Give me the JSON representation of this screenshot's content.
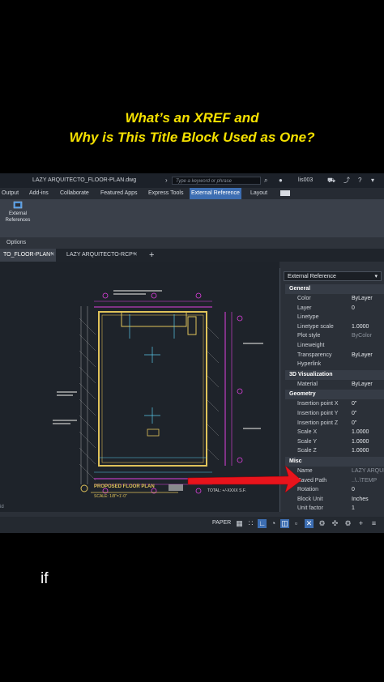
{
  "caption": {
    "line1": "What’s an XREF and",
    "line2": "Why is This Title Block Used as One?"
  },
  "app": {
    "window_title": "LAZY ARQUITECTO_FLOOR-PLAN.dwg",
    "search_placeholder": "Type a keyword or phrase",
    "user": "lis003",
    "ribbon_tabs": [
      "Output",
      "Add-ins",
      "Collaborate",
      "Featured Apps",
      "Express Tools",
      "External Reference",
      "Layout"
    ],
    "active_ribbon_tab": "External Reference",
    "ribbon_button": {
      "line1": "External",
      "line2": "References"
    },
    "ribbon_panel": "Options",
    "file_tabs": [
      "TO_FLOOR-PLAN*",
      "LAZY ARQUITECTO-RCP*"
    ],
    "command_prefix": "id",
    "drawing": {
      "plan_label": "PROPOSED FLOOR PLAN",
      "scale_label": "SCALE: 1/8\"=1'-0\"",
      "total_label": "TOTAL: +/-XXXX S.F."
    }
  },
  "properties": {
    "header": "External Reference",
    "sections": [
      {
        "title": "General",
        "rows": [
          {
            "key": "Color",
            "value": "ByLayer"
          },
          {
            "key": "Layer",
            "value": "0"
          },
          {
            "key": "Linetype",
            "value": ""
          },
          {
            "key": "Linetype scale",
            "value": "1.0000"
          },
          {
            "key": "Plot style",
            "value": "ByColor"
          },
          {
            "key": "Lineweight",
            "value": ""
          },
          {
            "key": "Transparency",
            "value": "ByLayer"
          },
          {
            "key": "Hyperlink",
            "value": ""
          }
        ]
      },
      {
        "title": "3D Visualization",
        "rows": [
          {
            "key": "Material",
            "value": "ByLayer"
          }
        ]
      },
      {
        "title": "Geometry",
        "rows": [
          {
            "key": "Insertion point X",
            "value": "0\""
          },
          {
            "key": "Insertion point Y",
            "value": "0\""
          },
          {
            "key": "Insertion point Z",
            "value": "0\""
          },
          {
            "key": "Scale X",
            "value": "1.0000"
          },
          {
            "key": "Scale Y",
            "value": "1.0000"
          },
          {
            "key": "Scale Z",
            "value": "1.0000"
          }
        ]
      },
      {
        "title": "Misc",
        "rows": [
          {
            "key": "Name",
            "value": "LAZY ARQUI"
          },
          {
            "key": "Saved Path",
            "value": "..\\..\\TEMP"
          },
          {
            "key": "Rotation",
            "value": "0"
          },
          {
            "key": "Block Unit",
            "value": "Inches"
          },
          {
            "key": "Unit factor",
            "value": "1"
          }
        ]
      }
    ]
  },
  "statusbar": {
    "layout": "PAPER"
  },
  "subtitle_text": "if",
  "colors": {
    "caption": "#f5e100",
    "arrow": "#e8141c",
    "accent": "#3d6eb2"
  }
}
